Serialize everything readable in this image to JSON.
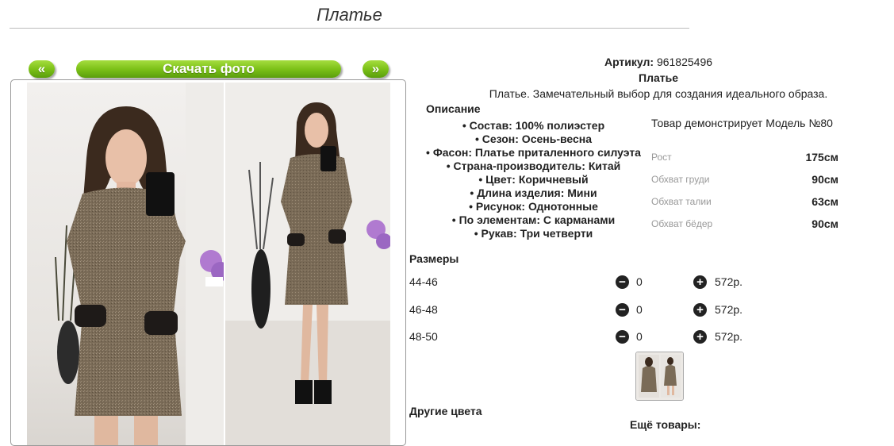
{
  "page": {
    "title": "Платье"
  },
  "gallery": {
    "prev_label": "«",
    "download_label": "Скачать фото",
    "next_label": "»"
  },
  "product": {
    "article_label": "Артикул:",
    "article_value": "961825496",
    "name": "Платье",
    "description": "Платье. Замечательный выбор для создания идеального образа.",
    "description_heading": "Описание",
    "properties": [
      "Состав: 100% полиэстер",
      "Сезон: Осень-весна",
      "Фасон: Платье приталенного силуэта",
      "Страна-производитель: Китай",
      "Цвет: Коричневый",
      "Длина изделия: Мини",
      "Рисунок: Однотонные",
      "По элементам: С карманами",
      "Рукав: Три четверти"
    ]
  },
  "model": {
    "title": "Товар демонстрирует Модель №80",
    "measures": [
      {
        "label": "Рост",
        "value": "175см"
      },
      {
        "label": "Обхват груди",
        "value": "90см"
      },
      {
        "label": "Обхват талии",
        "value": "63см"
      },
      {
        "label": "Обхват бёдер",
        "value": "90см"
      }
    ]
  },
  "sizes": {
    "heading": "Размеры",
    "rows": [
      {
        "size": "44-46",
        "qty": "0",
        "price": "572р."
      },
      {
        "size": "46-48",
        "qty": "0",
        "price": "572р."
      },
      {
        "size": "48-50",
        "qty": "0",
        "price": "572р."
      }
    ],
    "minus_icon": "minus-circle-icon",
    "plus_icon": "plus-circle-icon"
  },
  "other_colors_heading": "Другие цвета",
  "more_goods_heading": "Ещё товары:",
  "colors": {
    "button_green": "#7cc118",
    "icon_dark": "#222222"
  }
}
